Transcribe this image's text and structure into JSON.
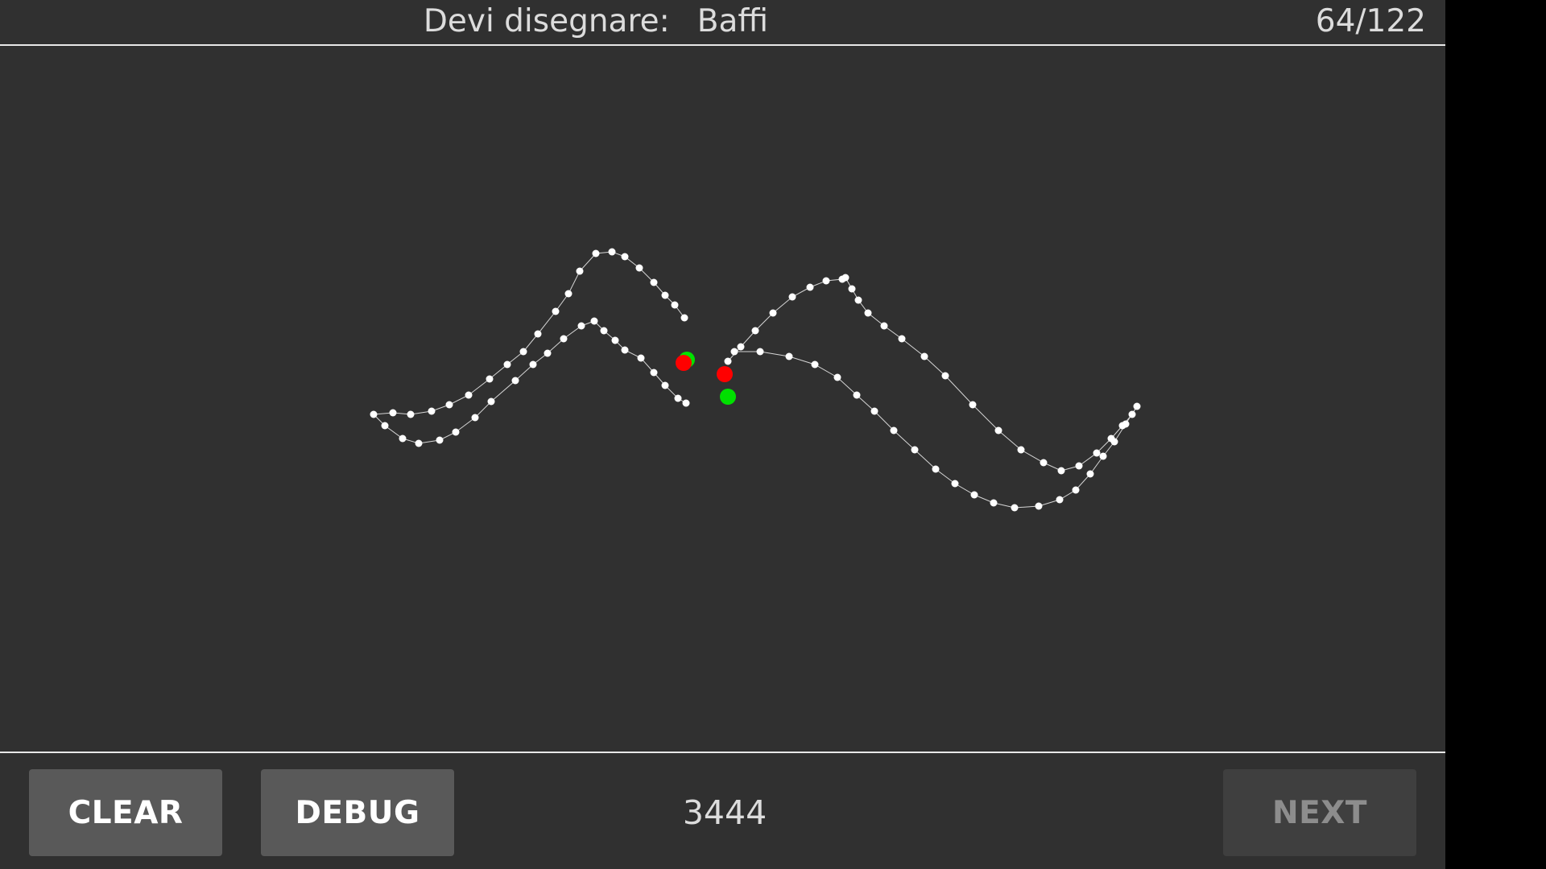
{
  "header": {
    "prompt_label": "Devi disegnare:",
    "prompt_word": "Baffi",
    "progress": "64/122"
  },
  "footer": {
    "clear_label": "CLEAR",
    "debug_label": "DEBUG",
    "score": "3444",
    "next_label": "NEXT"
  },
  "colors": {
    "background": "#303030",
    "stroke": "#ffffff",
    "start_marker": "#00e000",
    "end_marker": "#ff0000"
  },
  "icons": [
    "stroke-start-marker",
    "stroke-end-marker"
  ]
}
